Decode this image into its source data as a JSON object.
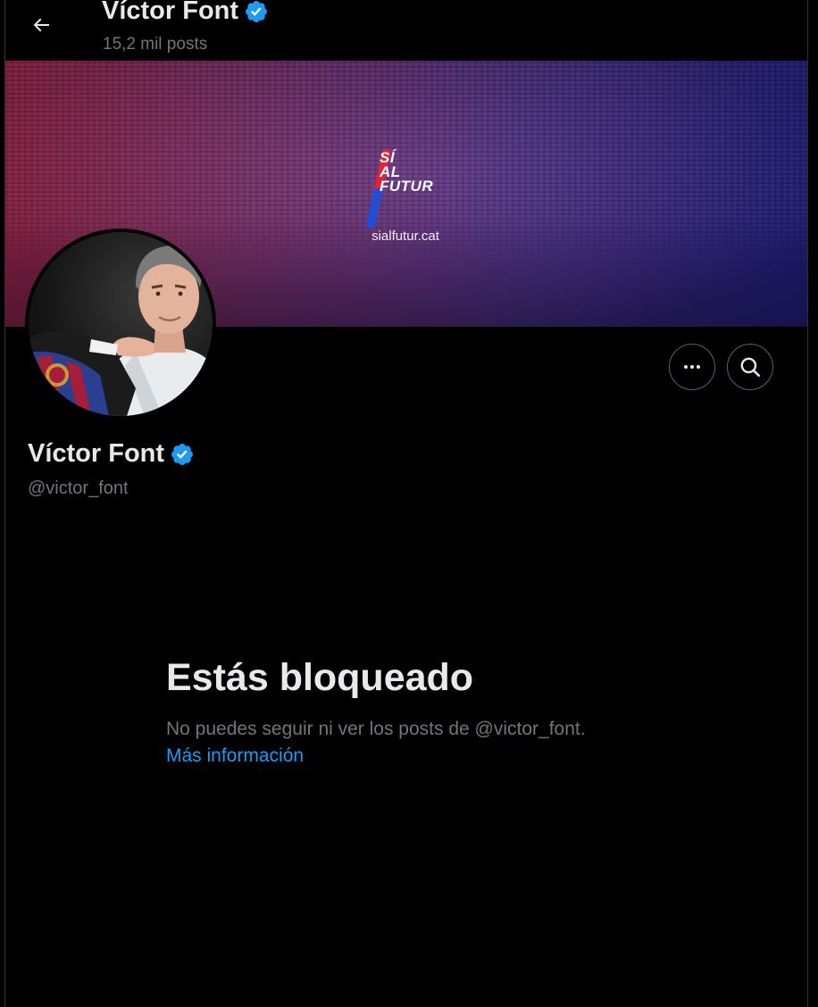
{
  "header": {
    "name": "Víctor Font",
    "posts_count": "15,2 mil posts",
    "back_icon": "arrow-left-icon"
  },
  "banner": {
    "logo_text": "SÍ\nAL\nFUTUR",
    "url": "sialfutur.cat",
    "colors": {
      "left": "#a6274f",
      "right": "#26218e"
    }
  },
  "profile": {
    "name": "Víctor Font",
    "handle": "@victor_font",
    "verified_color": "#1d9bf0"
  },
  "actions": {
    "more_icon": "more-horizontal-icon",
    "search_icon": "search-icon"
  },
  "blocked": {
    "title": "Estás bloqueado",
    "description": "No puedes seguir ni ver los posts de @victor_font.",
    "link": "Más información"
  }
}
